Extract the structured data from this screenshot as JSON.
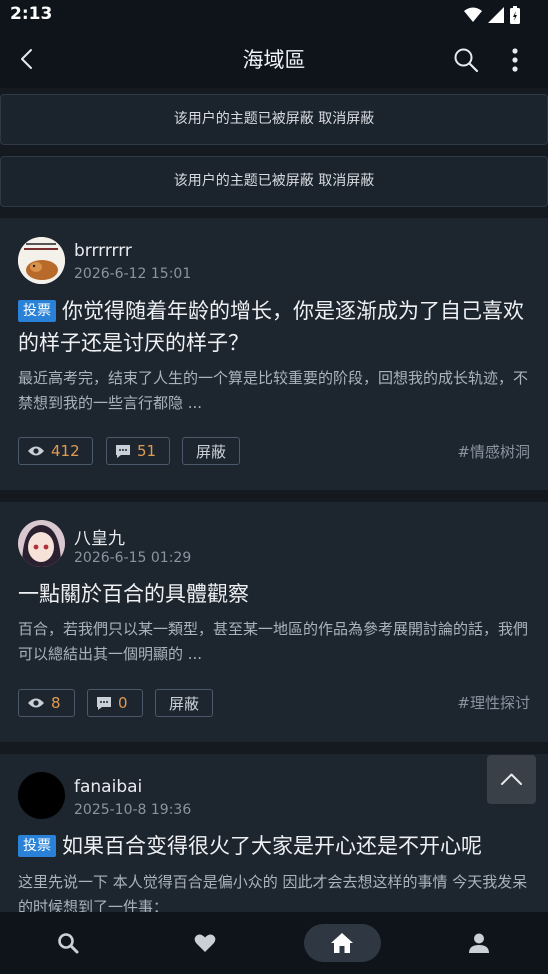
{
  "status_bar": {
    "time": "2:13"
  },
  "app_bar": {
    "title": "海域區"
  },
  "blocked_notices": [
    {
      "text": "该用户的主题已被屏蔽 取消屏蔽"
    },
    {
      "text": "该用户的主题已被屏蔽 取消屏蔽"
    }
  ],
  "posts": [
    {
      "author": "brrrrrrr",
      "date": "2026-6-12 15:01",
      "badge": "投票",
      "title": "你觉得随着年龄的增长，你是逐渐成为了自己喜欢的样子还是讨厌的样子？",
      "excerpt": "最近高考完，结束了人生的一个算是比较重要的阶段，回想我的成长轨迹，不禁想到我的一些言行都隐 ...",
      "views": "412",
      "comments": "51",
      "block_label": "屏蔽",
      "tag": "#情感树洞"
    },
    {
      "author": "八皇九",
      "date": "2026-6-15 01:29",
      "badge": "",
      "title": "一點關於百合的具體觀察",
      "excerpt": "百合，若我們只以某一類型，甚至某一地區的作品為參考展開討論的話，我們可以總結出其一個明顯的 ...",
      "views": "8",
      "comments": "0",
      "block_label": "屏蔽",
      "tag": "#理性探讨"
    },
    {
      "author": "fanaibai",
      "date": "2025-10-8 19:36",
      "badge": "投票",
      "title": "如果百合变得很火了大家是开心还是不开心呢",
      "excerpt": "这里先说一下 本人觉得百合是偏小众的 因此才会去想这样的事情 今天我发呆的时候想到了一件事：",
      "views": "",
      "comments": "",
      "block_label": "",
      "tag": ""
    }
  ],
  "bottom_nav": {
    "items": [
      "search-icon",
      "heart-icon",
      "home-icon",
      "person-icon"
    ],
    "active": "home-icon"
  },
  "colors": {
    "accent_badge": "#2a82d8",
    "chip_number": "#e19a52",
    "background": "#1a2129"
  }
}
